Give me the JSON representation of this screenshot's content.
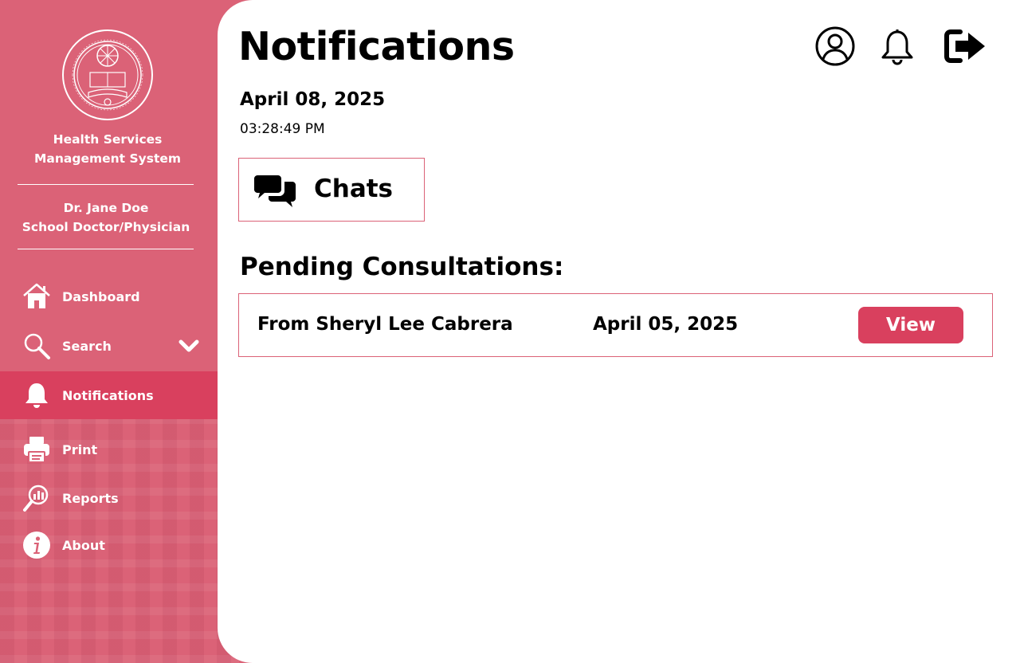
{
  "sidebar": {
    "brand_line1": "Health Services",
    "brand_line2": "Management System",
    "user_name": "Dr. Jane Doe",
    "user_role": "School Doctor/Physician",
    "items": [
      {
        "label": "Dashboard",
        "icon": "home-icon"
      },
      {
        "label": "Search",
        "icon": "search-icon"
      },
      {
        "label": "Notifications",
        "icon": "bell-icon",
        "active": true
      },
      {
        "label": "Print",
        "icon": "printer-icon"
      },
      {
        "label": "Reports",
        "icon": "reports-icon"
      },
      {
        "label": "About",
        "icon": "info-icon"
      }
    ]
  },
  "header": {
    "title": "Notifications",
    "icons": [
      "user-profile-icon",
      "bell-icon",
      "logout-icon"
    ]
  },
  "datetime": {
    "date": "April 08, 2025",
    "time": "03:28:49 PM"
  },
  "chats": {
    "label": "Chats",
    "icon": "chat-bubbles-icon"
  },
  "pending": {
    "title": "Pending Consultations:",
    "rows": [
      {
        "from": "From Sheryl Lee Cabrera",
        "date": "April 05, 2025",
        "action": "View"
      }
    ]
  },
  "colors": {
    "sidebar_bg": "#db6277",
    "active_bg": "#d9405e",
    "accent": "#d9405e",
    "border": "#db6277"
  }
}
